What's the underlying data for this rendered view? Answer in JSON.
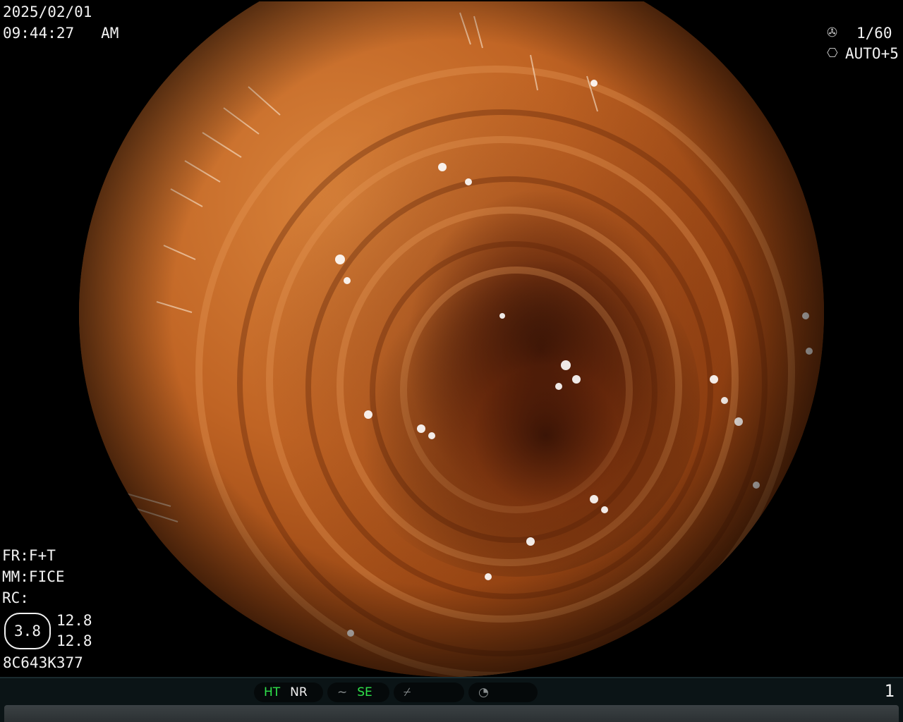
{
  "datetime": {
    "date": "2025/02/01",
    "time": "09:44:27",
    "ampm": "AM"
  },
  "exposure": {
    "shutter_icon": "shutter-aperture-icon",
    "shutter": "1/60",
    "iris_icon": "iris-ring-icon",
    "iris": "AUTO+5"
  },
  "settings": {
    "fr": "FR:F+T",
    "mm": "MM:FICE",
    "rc": "RC:",
    "ratio": "3.8",
    "value_1": "12.8",
    "value_2": "12.8",
    "serial": "8C643K377"
  },
  "status_bar": {
    "ht": "HT",
    "nr": "NR",
    "se": "SE",
    "page": "1",
    "colors": {
      "active": "#2fe24a",
      "inactive": "#f0f0f0"
    }
  }
}
